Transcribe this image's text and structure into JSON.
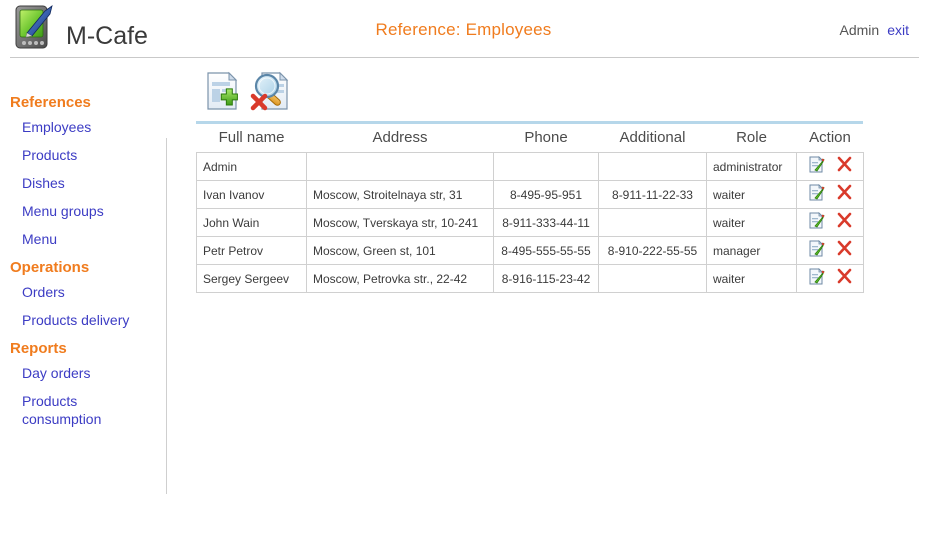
{
  "app": {
    "brand_name": "M-Cafe",
    "logo_icon": "pda-pen-icon",
    "page_title": "Reference: Employees",
    "accent_color": "#f07c1e",
    "link_color": "#3c3cc4",
    "table_top_rule_color": "#b6d7ea"
  },
  "user": {
    "name": "Admin",
    "exit_label": "exit"
  },
  "sidebar": {
    "groups": [
      {
        "title": "References",
        "items": [
          {
            "label": "Employees"
          },
          {
            "label": "Products"
          },
          {
            "label": "Dishes"
          },
          {
            "label": "Menu groups"
          },
          {
            "label": "Menu"
          }
        ]
      },
      {
        "title": "Operations",
        "items": [
          {
            "label": "Orders"
          },
          {
            "label": "Products delivery"
          }
        ]
      },
      {
        "title": "Reports",
        "items": [
          {
            "label": "Day orders"
          },
          {
            "label": "Products consumption"
          }
        ]
      }
    ]
  },
  "toolbar": {
    "buttons": [
      {
        "icon": "add-document-icon",
        "title": "Add"
      },
      {
        "icon": "search-clear-icon",
        "title": "Search"
      }
    ]
  },
  "table": {
    "columns": [
      "Full name",
      "Address",
      "Phone",
      "Additional",
      "Role",
      "Action"
    ],
    "row_action_icons": {
      "edit": "edit-document-icon",
      "delete": "delete-x-icon"
    },
    "rows": [
      {
        "full_name": "Admin",
        "address": "",
        "phone": "",
        "additional": "",
        "role": "administrator"
      },
      {
        "full_name": "Ivan Ivanov",
        "address": "Moscow, Stroitelnaya str, 31",
        "phone": "8-495-95-951",
        "additional": "8-911-11-22-33",
        "role": "waiter"
      },
      {
        "full_name": "John Wain",
        "address": "Moscow, Tverskaya str, 10-241",
        "phone": "8-911-333-44-11",
        "additional": "",
        "role": "waiter"
      },
      {
        "full_name": "Petr Petrov",
        "address": "Moscow, Green st, 101",
        "phone": "8-495-555-55-55",
        "additional": "8-910-222-55-55",
        "role": "manager"
      },
      {
        "full_name": "Sergey Sergeev",
        "address": "Moscow, Petrovka str., 22-42",
        "phone": "8-916-115-23-42",
        "additional": "",
        "role": "waiter"
      }
    ]
  }
}
